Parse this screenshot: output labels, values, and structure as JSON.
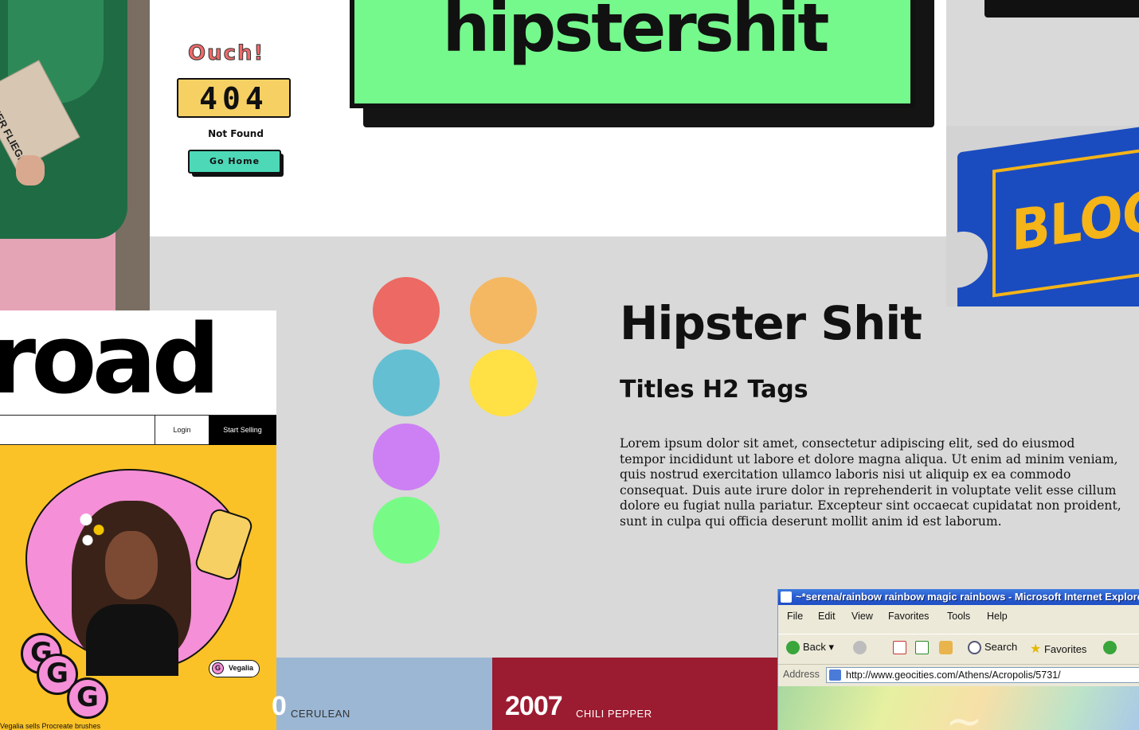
{
  "photo_left": {
    "book_text": "PAPIER FLIEGER"
  },
  "error_widget": {
    "exclaim": "Ouch!",
    "code": "404",
    "message": "Not Found",
    "button_label": "Go Home",
    "accent_colors": {
      "exclaim": "#f06a6a",
      "code_bg": "#f6d063",
      "button_bg": "#4dd8b8"
    }
  },
  "banner": {
    "text": "hipstershit",
    "bg_color": "#75f98d"
  },
  "ticket": {
    "text": "BLOCK",
    "bg_color": "#1b4cbf",
    "accent_color": "#f5b418"
  },
  "palette": {
    "swatches": [
      {
        "name": "red",
        "color": "#ec6a63"
      },
      {
        "name": "orange",
        "color": "#f4b862"
      },
      {
        "name": "blue",
        "color": "#65bfd2"
      },
      {
        "name": "yellow",
        "color": "#ffe045"
      },
      {
        "name": "purple",
        "color": "#cd80f4"
      },
      {
        "name": "green",
        "color": "#78fb86"
      }
    ]
  },
  "typography": {
    "h1": "Hipster Shit",
    "h2": "Titles H2 Tags",
    "paragraph": "Lorem ipsum dolor sit amet, consectetur adipiscing elit, sed do eiusmod tempor incididunt ut labore et dolore magna aliqua. Ut enim ad minim veniam, quis nostrud exercitation ullamco laboris nisi ut aliquip ex ea commodo consequat. Duis aute irure dolor in reprehenderit in voluptate velit esse cillum dolore eu fugiat nulla pariatur. Excepteur sint occaecat cupidatat non proident, sunt in culpa qui officia deserunt mollit anim id est laborum."
  },
  "road_card": {
    "wordmark": "road",
    "login_label": "Login",
    "sell_label": "Start Selling",
    "pill_label": "Vegalia",
    "pill_glyph": "G",
    "sticker_letters": [
      "G",
      "G",
      "G"
    ],
    "caption": "Vegalia sells Procreate brushes",
    "colors": {
      "hero_bg": "#fbc227",
      "blob": "#f58fd7"
    }
  },
  "pantone": {
    "strips": [
      {
        "year": "0",
        "name": "CERULEAN",
        "color": "#9bb7d4"
      },
      {
        "year": "2007",
        "name": "CHILI PEPPER",
        "color": "#9b1b30"
      }
    ]
  },
  "browser": {
    "title": "~*serena/rainbow rainbow magic rainbows - Microsoft Internet Explorer",
    "menu": [
      "File",
      "Edit",
      "View",
      "Favorites",
      "Tools",
      "Help"
    ],
    "toolbar": {
      "back": "Back",
      "search": "Search",
      "favorites": "Favorites"
    },
    "address_label": "Address",
    "address_url": "http://www.geocities.com/Athens/Acropolis/5731/"
  }
}
